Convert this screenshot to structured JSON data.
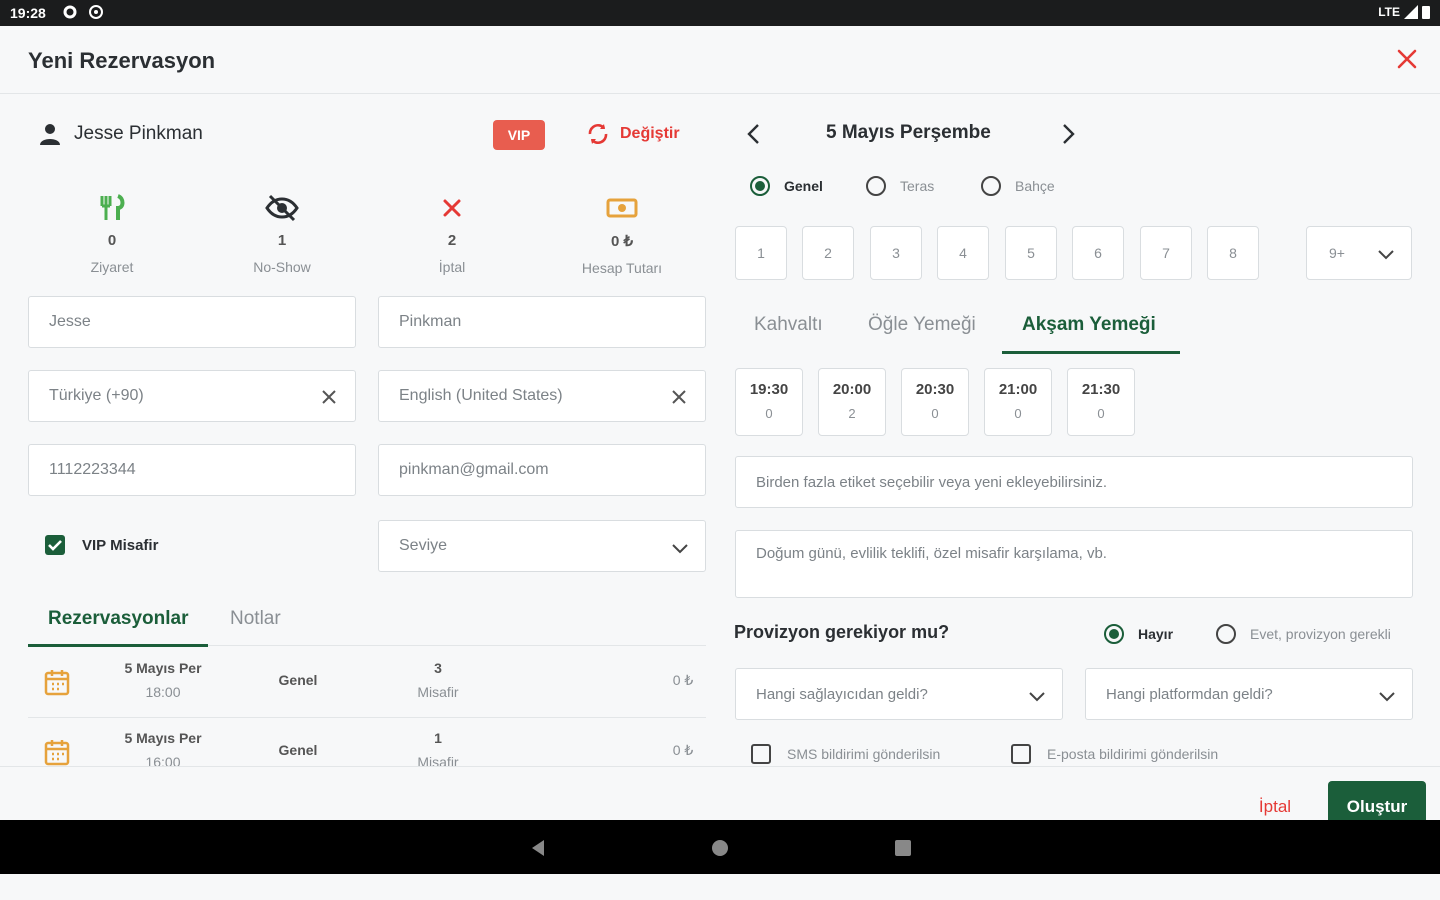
{
  "status_bar": {
    "time": "19:28",
    "network": "LTE"
  },
  "header": {
    "title": "Yeni Rezervasyon"
  },
  "guest": {
    "name": "Jesse Pinkman",
    "vip_badge": "VIP",
    "change_label": "Değiştir"
  },
  "stats": [
    {
      "value": "0",
      "label": "Ziyaret",
      "icon": "fork-knife-icon",
      "color": "#4caf50"
    },
    {
      "value": "1",
      "label": "No-Show",
      "icon": "eye-off-icon",
      "color": "#2b2f33"
    },
    {
      "value": "2",
      "label": "İptal",
      "icon": "x-icon",
      "color": "#e53935"
    },
    {
      "value": "0 ₺",
      "label": "Hesap Tutarı",
      "icon": "cash-icon",
      "color": "#e6a23c"
    }
  ],
  "form": {
    "first_name": "Jesse",
    "last_name": "Pinkman",
    "country": "Türkiye (+90)",
    "language": "English (United States)",
    "phone": "1112223344",
    "email": "pinkman@gmail.com",
    "vip_checkbox": "VIP Misafir",
    "level_placeholder": "Seviye"
  },
  "left_tabs": {
    "reservations": "Rezervasyonlar",
    "notes": "Notlar"
  },
  "reservations": [
    {
      "date": "5 Mayıs Per",
      "time": "18:00",
      "area": "Genel",
      "count": "3",
      "guest_label": "Misafir",
      "amount": "0 ₺"
    },
    {
      "date": "5 Mayıs Per",
      "time": "16:00",
      "area": "Genel",
      "count": "1",
      "guest_label": "Misafir",
      "amount": "0 ₺"
    }
  ],
  "date": {
    "title": "5 Mayıs Perşembe"
  },
  "areas": [
    {
      "label": "Genel",
      "selected": true
    },
    {
      "label": "Teras",
      "selected": false
    },
    {
      "label": "Bahçe",
      "selected": false
    }
  ],
  "party_sizes": [
    "1",
    "2",
    "3",
    "4",
    "5",
    "6",
    "7",
    "8"
  ],
  "party_more": "9+",
  "meal_tabs": [
    {
      "label": "Kahvaltı",
      "active": false
    },
    {
      "label": "Öğle Yemeği",
      "active": false
    },
    {
      "label": "Akşam Yemeği",
      "active": true
    }
  ],
  "time_slots": [
    {
      "time": "19:30",
      "count": "0"
    },
    {
      "time": "20:00",
      "count": "2"
    },
    {
      "time": "20:30",
      "count": "0"
    },
    {
      "time": "21:00",
      "count": "0"
    },
    {
      "time": "21:30",
      "count": "0"
    }
  ],
  "tags_placeholder": "Birden fazla etiket seçebilir veya yeni ekleyebilirsiniz.",
  "notes_placeholder": "Doğum günü, evlilik teklifi, özel misafir karşılama, vb.",
  "provision": {
    "question": "Provizyon gerekiyor mu?",
    "no": "Hayır",
    "yes": "Evet, provizyon gerekli"
  },
  "source": {
    "provider_placeholder": "Hangi sağlayıcıdan geldi?",
    "platform_placeholder": "Hangi platformdan geldi?"
  },
  "notify": {
    "sms": "SMS bildirimi gönderilsin",
    "email": "E-posta bildirimi gönderilsin"
  },
  "footer": {
    "cancel": "İptal",
    "create": "Oluştur"
  },
  "colors": {
    "primary": "#1b5e3a",
    "danger": "#e53935",
    "vip": "#e85d4f"
  }
}
